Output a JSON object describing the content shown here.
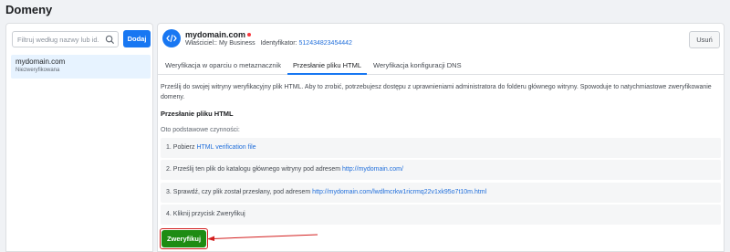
{
  "page": {
    "title": "Domeny"
  },
  "sidebar": {
    "search_placeholder": "Filtruj według nazwy lub id...",
    "add_label": "Dodaj",
    "items": [
      {
        "name": "mydomain.com",
        "status": "Niezweryfikowana"
      }
    ]
  },
  "domain": {
    "name": "mydomain.com",
    "owner_label": "Właściciel:: My Business",
    "id_label": "Identyfikator:",
    "id_value": "512434823454442",
    "remove_label": "Usuń",
    "status_color": "#fa383e"
  },
  "tabs": [
    {
      "label": "Weryfikacja w oparciu o metaznacznik",
      "active": false
    },
    {
      "label": "Przesłanie pliku HTML",
      "active": true
    },
    {
      "label": "Weryfikacja konfiguracji DNS",
      "active": false
    }
  ],
  "content": {
    "intro": "Prześlij do swojej witryny weryfikacyjny plik HTML. Aby to zrobić, potrzebujesz dostępu z uprawnieniami administratora do folderu głównego witryny. Spowoduje to natychmiastowe zweryfikowanie domeny.",
    "section_heading": "Przesłanie pliku HTML",
    "steps_intro": "Oto podstawowe czynności:",
    "step1_prefix": "1. Pobierz ",
    "step1_link": "HTML verification file",
    "step2_prefix": "2. Prześlij ten plik do katalogu głównego witryny pod adresem ",
    "step2_link": "http://mydomain.com/",
    "step3_prefix": "3. Sprawdź, czy plik został przesłany, pod adresem ",
    "step3_link": "http://mydomain.com/lwdlmcrkw1ricrmq22v1xk95o7t10m.html",
    "step4": "4. Kliknij przycisk Zweryfikuj",
    "verify_label": "Zweryfikuj"
  },
  "colors": {
    "accent": "#1877f2",
    "verify_green": "#1e8c13",
    "annotation_red": "#d31f1f",
    "link": "#216fdb"
  }
}
